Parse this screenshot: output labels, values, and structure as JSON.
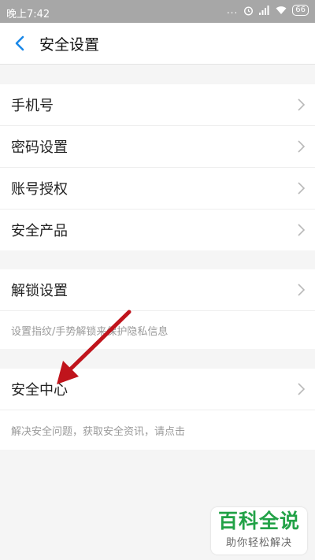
{
  "status_bar": {
    "time": "晚上7:42",
    "dots": "...",
    "battery": "66"
  },
  "header": {
    "back_icon": "chevron-left-icon",
    "title": "安全设置"
  },
  "groups": [
    {
      "items": [
        {
          "label": "手机号"
        },
        {
          "label": "密码设置"
        },
        {
          "label": "账号授权"
        },
        {
          "label": "安全产品"
        }
      ]
    },
    {
      "items": [
        {
          "label": "解锁设置"
        }
      ],
      "description": "设置指纹/手势解锁来保护隐私信息"
    },
    {
      "items": [
        {
          "label": "安全中心"
        }
      ],
      "description": "解决安全问题，获取安全资讯，请点击"
    }
  ],
  "annotation": {
    "color": "#c0141c"
  },
  "watermark": {
    "title": "百科全说",
    "subtitle": "助你轻松解决",
    "color": "#22a247"
  },
  "colors": {
    "accent": "#1a88e8",
    "statusbar": "#a7a7a7",
    "background": "#f5f5f5"
  }
}
